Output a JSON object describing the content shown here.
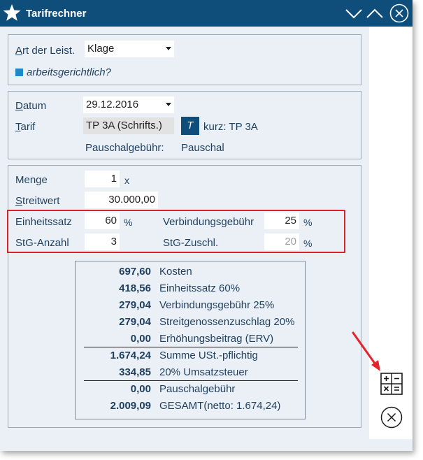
{
  "window": {
    "title": "Tarifrechner",
    "icons": {
      "app": "star-icon",
      "collapse": "chevron-down-icon",
      "expand": "chevron-up-icon",
      "close": "close-circle-icon"
    }
  },
  "panel_art": {
    "art_label": "Art der Leist.",
    "art_value": "Klage",
    "checkbox_label": "arbeitsgerichtlich?"
  },
  "panel_tarif": {
    "datum_label": "Datum",
    "datum_value": "29.12.2016",
    "tarif_label": "Tarif",
    "tarif_value": "TP 3A (Schrifts.)",
    "tarif_button": "T",
    "kurz_label": "kurz: TP 3A",
    "pauschal_label": "Pauschalgebühr:",
    "pauschal_value": "Pauschal"
  },
  "panel_calc": {
    "menge_label": "Menge",
    "menge_value": "1",
    "menge_unit": "x",
    "streitwert_label": "Streitwert",
    "streitwert_value": "30.000,00",
    "einheitssatz_label": "Einheitssatz",
    "einheitssatz_value": "60",
    "einheitssatz_unit": "%",
    "verbindung_label": "Verbindungsgebühr",
    "verbindung_value": "25",
    "verbindung_unit": "%",
    "stg_anzahl_label": "StG-Anzahl",
    "stg_anzahl_value": "3",
    "stg_zuschl_label": "StG-Zuschl.",
    "stg_zuschl_value": "20",
    "stg_zuschl_unit": "%"
  },
  "summary": [
    {
      "amount": "697,60",
      "desc": "Kosten"
    },
    {
      "amount": "418,56",
      "desc": "Einheitssatz 60%"
    },
    {
      "amount": "279,04",
      "desc": "Verbindungsgebühr 25%"
    },
    {
      "amount": "279,04",
      "desc": "Streitgenossenzuschlag 20%"
    },
    {
      "amount": "0,00",
      "desc": "Erhöhungsbeitrag (ERV)"
    },
    {
      "amount": "1.674,24",
      "desc": "Summe USt.-pflichtig"
    },
    {
      "amount": "334,85",
      "desc": "20% Umsatzsteuer"
    },
    {
      "amount": "0,00",
      "desc": "Pauschalgebühr"
    },
    {
      "amount": "2.009,09",
      "desc": "GESAMT(netto: 1.674,24)"
    }
  ],
  "sidebar": {
    "calculator_icon": "calculator-icon",
    "cancel_icon": "close-circle-icon"
  },
  "annotation": {
    "color": "#d9232a"
  }
}
